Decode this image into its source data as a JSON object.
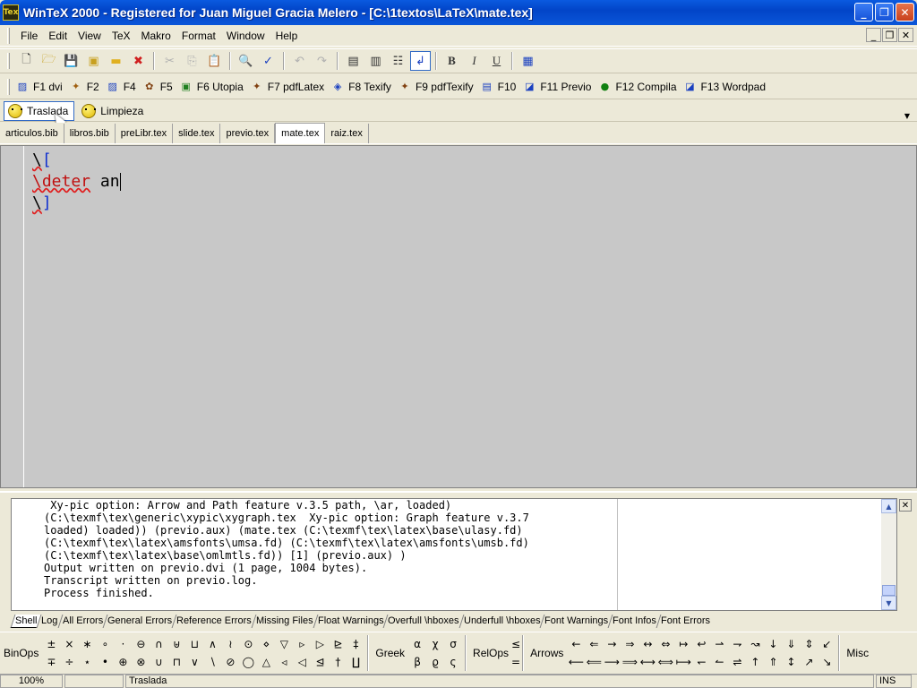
{
  "window": {
    "app_icon_text": "Tex",
    "title": "WinTeX 2000 - Registered for Juan Miguel Gracia Melero - [C:\\1textos\\LaTeX\\mate.tex]"
  },
  "menu": [
    "File",
    "Edit",
    "View",
    "TeX",
    "Makro",
    "Format",
    "Window",
    "Help"
  ],
  "toolbar2": [
    "F1 dvi",
    "F2",
    "F4",
    "F5",
    "F6 Utopia",
    "F7 pdfLatex",
    "F8 Texify",
    "F9 pdfTexify",
    "F10",
    "F11 Previo",
    "F12 Compila",
    "F13 Wordpad"
  ],
  "toolbar3": [
    "Traslada",
    "Limpieza"
  ],
  "tabs": [
    "articulos.bib",
    "libros.bib",
    "preLibr.tex",
    "slide.tex",
    "previo.tex",
    "mate.tex",
    "raiz.tex"
  ],
  "editor": {
    "line1_bs": "\\",
    "line1_br": "[",
    "line2_cmd": "\\deter",
    "line2_rest": " an",
    "line3_bs": "\\",
    "line3_br": "]"
  },
  "log": {
    "text": " Xy-pic option: Arrow and Path feature v.3.5 path, \\ar, loaded)\n(C:\\texmf\\tex\\generic\\xypic\\xygraph.tex  Xy-pic option: Graph feature v.3.7\nloaded) loaded)) (previo.aux) (mate.tex (C:\\texmf\\tex\\latex\\base\\ulasy.fd)\n(C:\\texmf\\tex\\latex\\amsfonts\\umsa.fd) (C:\\texmf\\tex\\latex\\amsfonts\\umsb.fd)\n(C:\\texmf\\tex\\latex\\base\\omlmtls.fd)) [1] (previo.aux) )\nOutput written on previo.dvi (1 page, 1004 bytes).\nTranscript written on previo.log.\nProcess finished."
  },
  "log_tabs": [
    "Shell",
    "Log",
    "All Errors",
    "General Errors",
    "Reference Errors",
    "Missing Files",
    "Float Warnings",
    "Overfull \\hboxes",
    "Underfull \\hboxes",
    "Font Warnings",
    "Font Infos",
    "Font Errors"
  ],
  "symbols": {
    "binops_label": "BinOps",
    "binops": [
      "±",
      "∓",
      "×",
      "÷",
      "∗",
      "⋆",
      "∘",
      "•",
      "·",
      "⊕",
      "⊖",
      "⊗",
      "∩",
      "∪",
      "⊎",
      "⊓",
      "⊔",
      "∨",
      "∧",
      "∖",
      "≀",
      "⊘",
      "⊙",
      "◯",
      "⋄",
      "△",
      "▽",
      "◃",
      "▹",
      "◁",
      "▷",
      "⊴",
      "⊵",
      "†",
      "‡",
      "∐"
    ],
    "greek_label": "Greek",
    "greek": [
      "α",
      "β",
      "χ",
      "ϱ",
      "σ",
      "ς"
    ],
    "relops_label": "RelOps",
    "arrows_label": "Arrows",
    "arrows": [
      "←",
      "⟵",
      "⇐",
      "⟸",
      "→",
      "⟶",
      "⇒",
      "⟹",
      "↔",
      "⟷",
      "⇔",
      "⟺",
      "↦",
      "⟼",
      "↩",
      "↽",
      "⇀",
      "↼",
      "⇁",
      "⇌",
      "↝",
      "↑",
      "↓",
      "⇑",
      "⇓",
      "↕",
      "⇕",
      "↗",
      "↙",
      "↘"
    ],
    "misc_label": "Misc"
  },
  "status": {
    "zoom": "100%",
    "empty": "",
    "message": "Traslada",
    "mode": "INS"
  }
}
